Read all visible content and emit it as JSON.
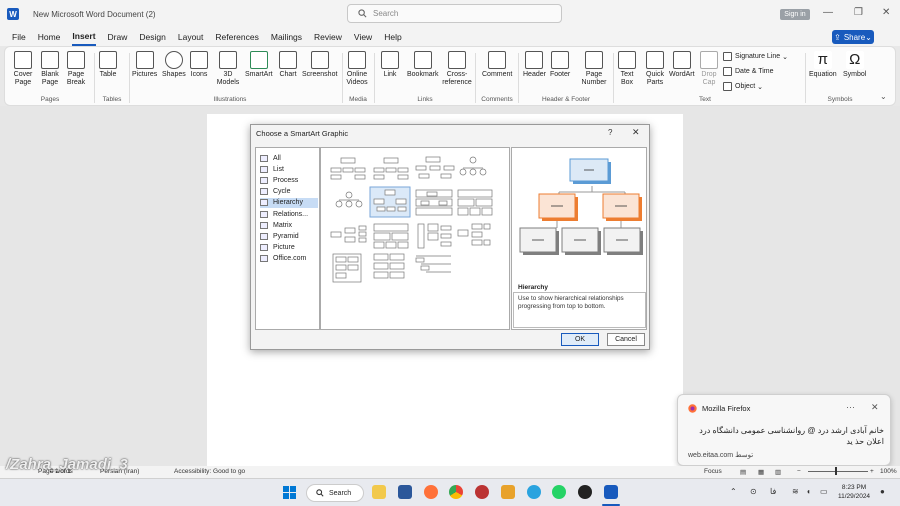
{
  "window": {
    "title": "New Microsoft Word Document (2)",
    "search_placeholder": "Search",
    "signin": "Sign in",
    "share": "Share"
  },
  "menu": [
    "File",
    "Home",
    "Insert",
    "Draw",
    "Design",
    "Layout",
    "References",
    "Mailings",
    "Review",
    "View",
    "Help"
  ],
  "menu_active": "Insert",
  "ribbon": {
    "pages": {
      "cover": "Cover Page",
      "blank": "Blank Page",
      "break": "Page Break",
      "label": "Pages"
    },
    "tables": {
      "table": "Table",
      "label": "Tables"
    },
    "illustrations": {
      "pictures": "Pictures",
      "shapes": "Shapes",
      "icons": "Icons",
      "models": "3D Models",
      "smartart": "SmartArt",
      "chart": "Chart",
      "screenshot": "Screenshot",
      "label": "Illustrations"
    },
    "media": {
      "online_videos": "Online Videos",
      "label": "Media"
    },
    "links": {
      "link": "Link",
      "bookmark": "Bookmark",
      "crossref": "Cross-reference",
      "label": "Links"
    },
    "comments": {
      "comment": "Comment",
      "label": "Comments"
    },
    "header_footer": {
      "header": "Header",
      "footer": "Footer",
      "page_number": "Page Number",
      "label": "Header & Footer"
    },
    "text": {
      "textbox": "Text Box",
      "quickparts": "Quick Parts",
      "wordart": "WordArt",
      "dropcap": "Drop Cap",
      "signature": "Signature Line",
      "datetime": "Date & Time",
      "object": "Object",
      "label": "Text"
    },
    "symbols": {
      "equation": "Equation",
      "symbol": "Symbol",
      "label": "Symbols"
    }
  },
  "dialog": {
    "title": "Choose a SmartArt Graphic",
    "help": "?",
    "categories": [
      "All",
      "List",
      "Process",
      "Cycle",
      "Hierarchy",
      "Relations...",
      "Matrix",
      "Pyramid",
      "Picture",
      "Office.com"
    ],
    "selected_category": "Hierarchy",
    "preview_name": "Hierarchy",
    "preview_desc": "Use to show hierarchical relationships progressing from top to bottom.",
    "ok": "OK",
    "cancel": "Cancel"
  },
  "statusbar": {
    "page": "Page 1 of 1",
    "words": "0 words",
    "language": "Persian (Iran)",
    "accessibility": "Accessibility: Good to go",
    "focus": "Focus",
    "zoom": "100%"
  },
  "watermark": "/Zahra_Jamadi_3",
  "toast": {
    "app": "Mozilla Firefox",
    "message": "خانم آبادی ارشد درد @ روانشناسی عمومی دانشگاه درد اعلان حذ ید",
    "source": "web.eitaa.com توسط"
  },
  "taskbar": {
    "search": "Search",
    "time": "8:23 PM",
    "date": "11/29/2024",
    "lang": "فا"
  },
  "colors": {
    "accent": "#185abd",
    "smartart_orange": "#ed7d31",
    "smartart_blue": "#5b9bd5"
  }
}
